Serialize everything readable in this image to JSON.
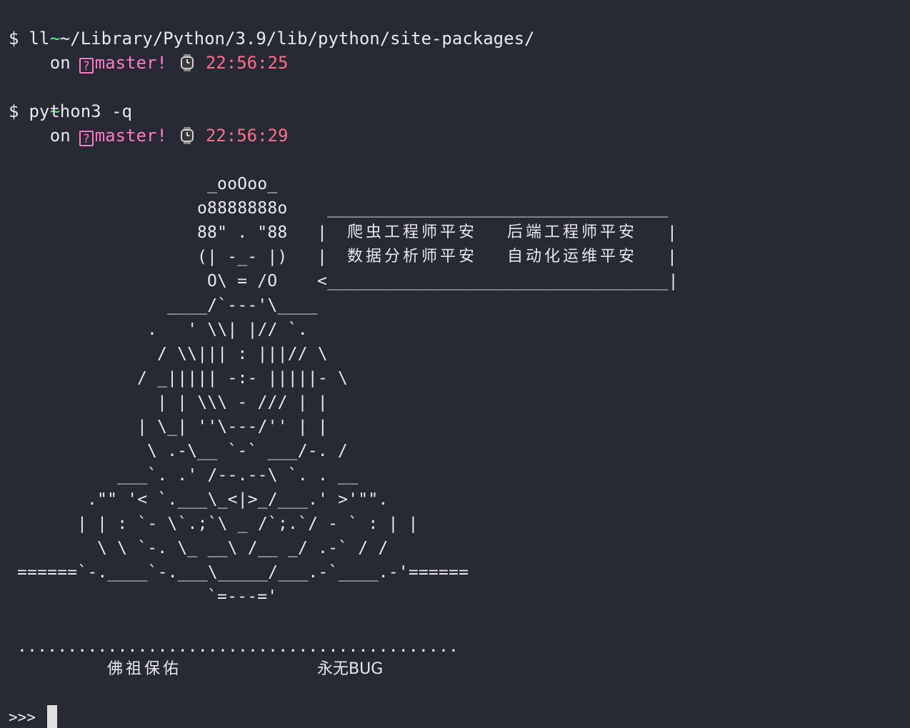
{
  "prompts": [
    {
      "tilde": "~",
      "on": "on",
      "branch_box": "?",
      "branch": "master!",
      "watch_icon": "watch-icon",
      "time": "22:56:25",
      "dollar": "$",
      "command": "ll ~/Library/Python/3.9/lib/python/site-packages/"
    },
    {
      "tilde": "~",
      "on": "on",
      "branch_box": "?",
      "branch": "master!",
      "watch_icon": "watch-icon",
      "time": "22:56:29",
      "dollar": "$",
      "command": "python3 -q"
    }
  ],
  "ascii_art": {
    "lines": [
      "_ooOoo_",
      "o8888888o",
      "88\" . \"88",
      "(| -_- |)",
      "O\\ = /O",
      "____/`---'\\____",
      ".   ' \\\\| |// `.",
      "/ \\\\||| : |||// \\",
      "/ _||||| -:- |||||- \\",
      "| | \\\\\\ - /// | |",
      "| \\_| ''\\---/'' | |",
      "\\ .-\\__ `-` ___/-. /",
      "___`. .' /--.--\\ `. . __",
      ".\"\" '< `.___\\_<|>_/___.' >'\"\".",
      "| | : `- \\`.;`\\ _ /`;.`/ - ` : | |",
      "\\ \\ `-. \\_ __\\ /__ _/ .-` / /",
      "======`-.____`-.___\\_____/___.-`____.-'======",
      "`=---='"
    ],
    "dots": "............................................",
    "blessing_left": "佛祖保佑",
    "blessing_right": "永无BUG"
  },
  "speech_bubble": {
    "top": "__________________________________",
    "row1_left": "爬虫工程师平安",
    "row1_right": "后端工程师平安",
    "row2_left": "数据分析师平安",
    "row2_right": "自动化运维平安",
    "bar": "|",
    "bottom": "<__________________________________|"
  },
  "repl_prompt": ">>>",
  "colors": {
    "background": "#272935",
    "text": "#e8e8ea",
    "tilde": "#50fa7b",
    "branch": "#ff79c6",
    "time": "#ff6e8a"
  }
}
